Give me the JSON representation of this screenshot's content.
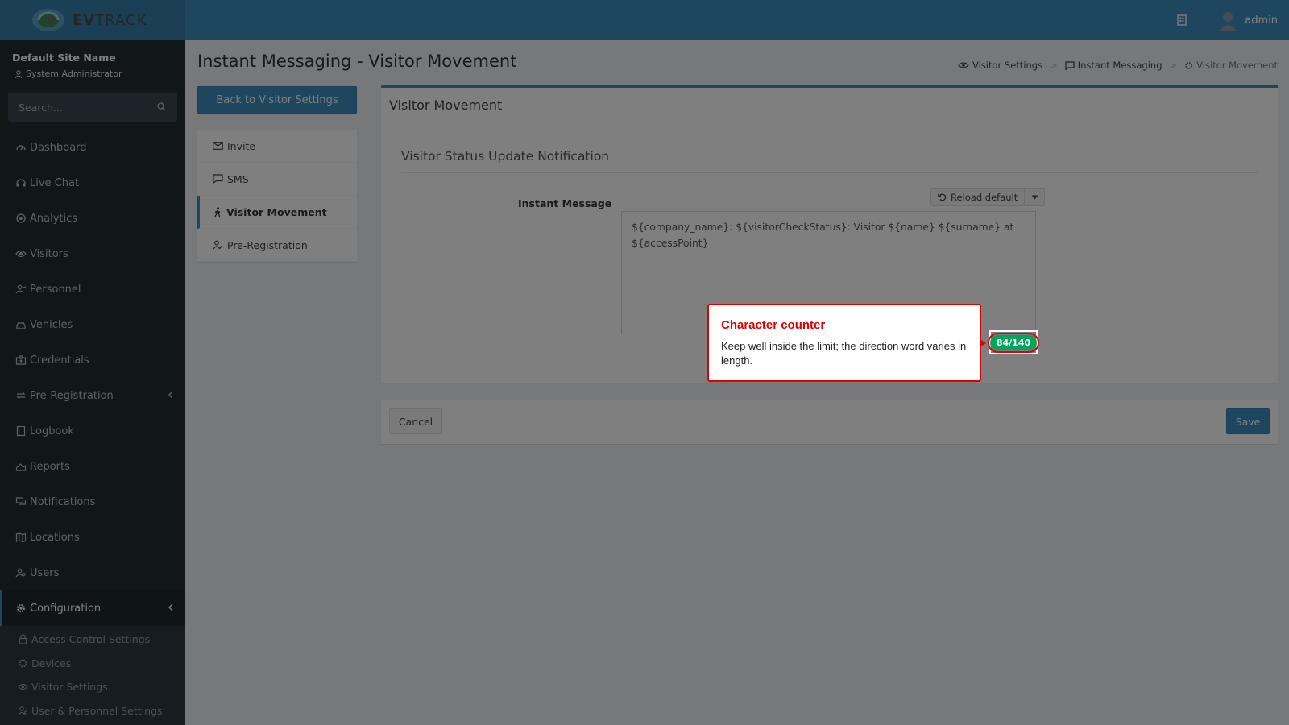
{
  "brand": {
    "logo_strong": "EV",
    "logo_rest": "TRACK"
  },
  "header": {
    "username": "admin"
  },
  "sidebar": {
    "site_name": "Default Site Name",
    "role": "System Administrator",
    "search_placeholder": "Search...",
    "items": [
      {
        "label": "Dashboard",
        "icon": "dashboard-icon"
      },
      {
        "label": "Live Chat",
        "icon": "headset-icon"
      },
      {
        "label": "Analytics",
        "icon": "analytics-icon"
      },
      {
        "label": "Visitors",
        "icon": "eye-icon"
      },
      {
        "label": "Personnel",
        "icon": "personnel-icon"
      },
      {
        "label": "Vehicles",
        "icon": "car-icon"
      },
      {
        "label": "Credentials",
        "icon": "credentials-icon"
      },
      {
        "label": "Pre-Registration",
        "icon": "exchange-icon"
      },
      {
        "label": "Logbook",
        "icon": "book-icon"
      },
      {
        "label": "Reports",
        "icon": "reports-icon"
      },
      {
        "label": "Notifications",
        "icon": "chat-icon"
      },
      {
        "label": "Locations",
        "icon": "map-icon"
      },
      {
        "label": "Users",
        "icon": "users-icon"
      },
      {
        "label": "Configuration",
        "icon": "gear-icon"
      }
    ],
    "subitems": [
      {
        "label": "Access Control Settings",
        "icon": "lock-icon"
      },
      {
        "label": "Devices",
        "icon": "devices-icon"
      },
      {
        "label": "Visitor Settings",
        "icon": "eye-icon"
      },
      {
        "label": "User & Personnel Settings",
        "icon": "users-icon"
      }
    ]
  },
  "page": {
    "title": "Instant Messaging - Visitor Movement",
    "breadcrumb": [
      "Visitor Settings",
      "Instant Messaging",
      "Visitor Movement"
    ],
    "back_button": "Back to Visitor Settings"
  },
  "side_nav": [
    {
      "label": "Invite",
      "icon": "envelope-icon"
    },
    {
      "label": "SMS",
      "icon": "message-icon"
    },
    {
      "label": "Visitor Movement",
      "icon": "walking-icon",
      "active": true
    },
    {
      "label": "Pre-Registration",
      "icon": "user-edit-icon"
    }
  ],
  "panel": {
    "title": "Visitor Movement",
    "section_title": "Visitor Status Update Notification",
    "field_label": "Instant Message",
    "reload_label": "Reload default",
    "message": "${company_name}: ${visitorCheckStatus}: Visitor ${name} ${surname} at ${accessPoint}",
    "counter": "84/140"
  },
  "footer": {
    "cancel": "Cancel",
    "save": "Save"
  },
  "callout": {
    "title": "Character counter",
    "body": "Keep well inside the limit; the direction word varies in length."
  },
  "colors": {
    "primary": "#3c8dbc",
    "sidebar_bg": "#222d32",
    "counter_bg": "#00a65a",
    "callout_red": "#e00000"
  }
}
